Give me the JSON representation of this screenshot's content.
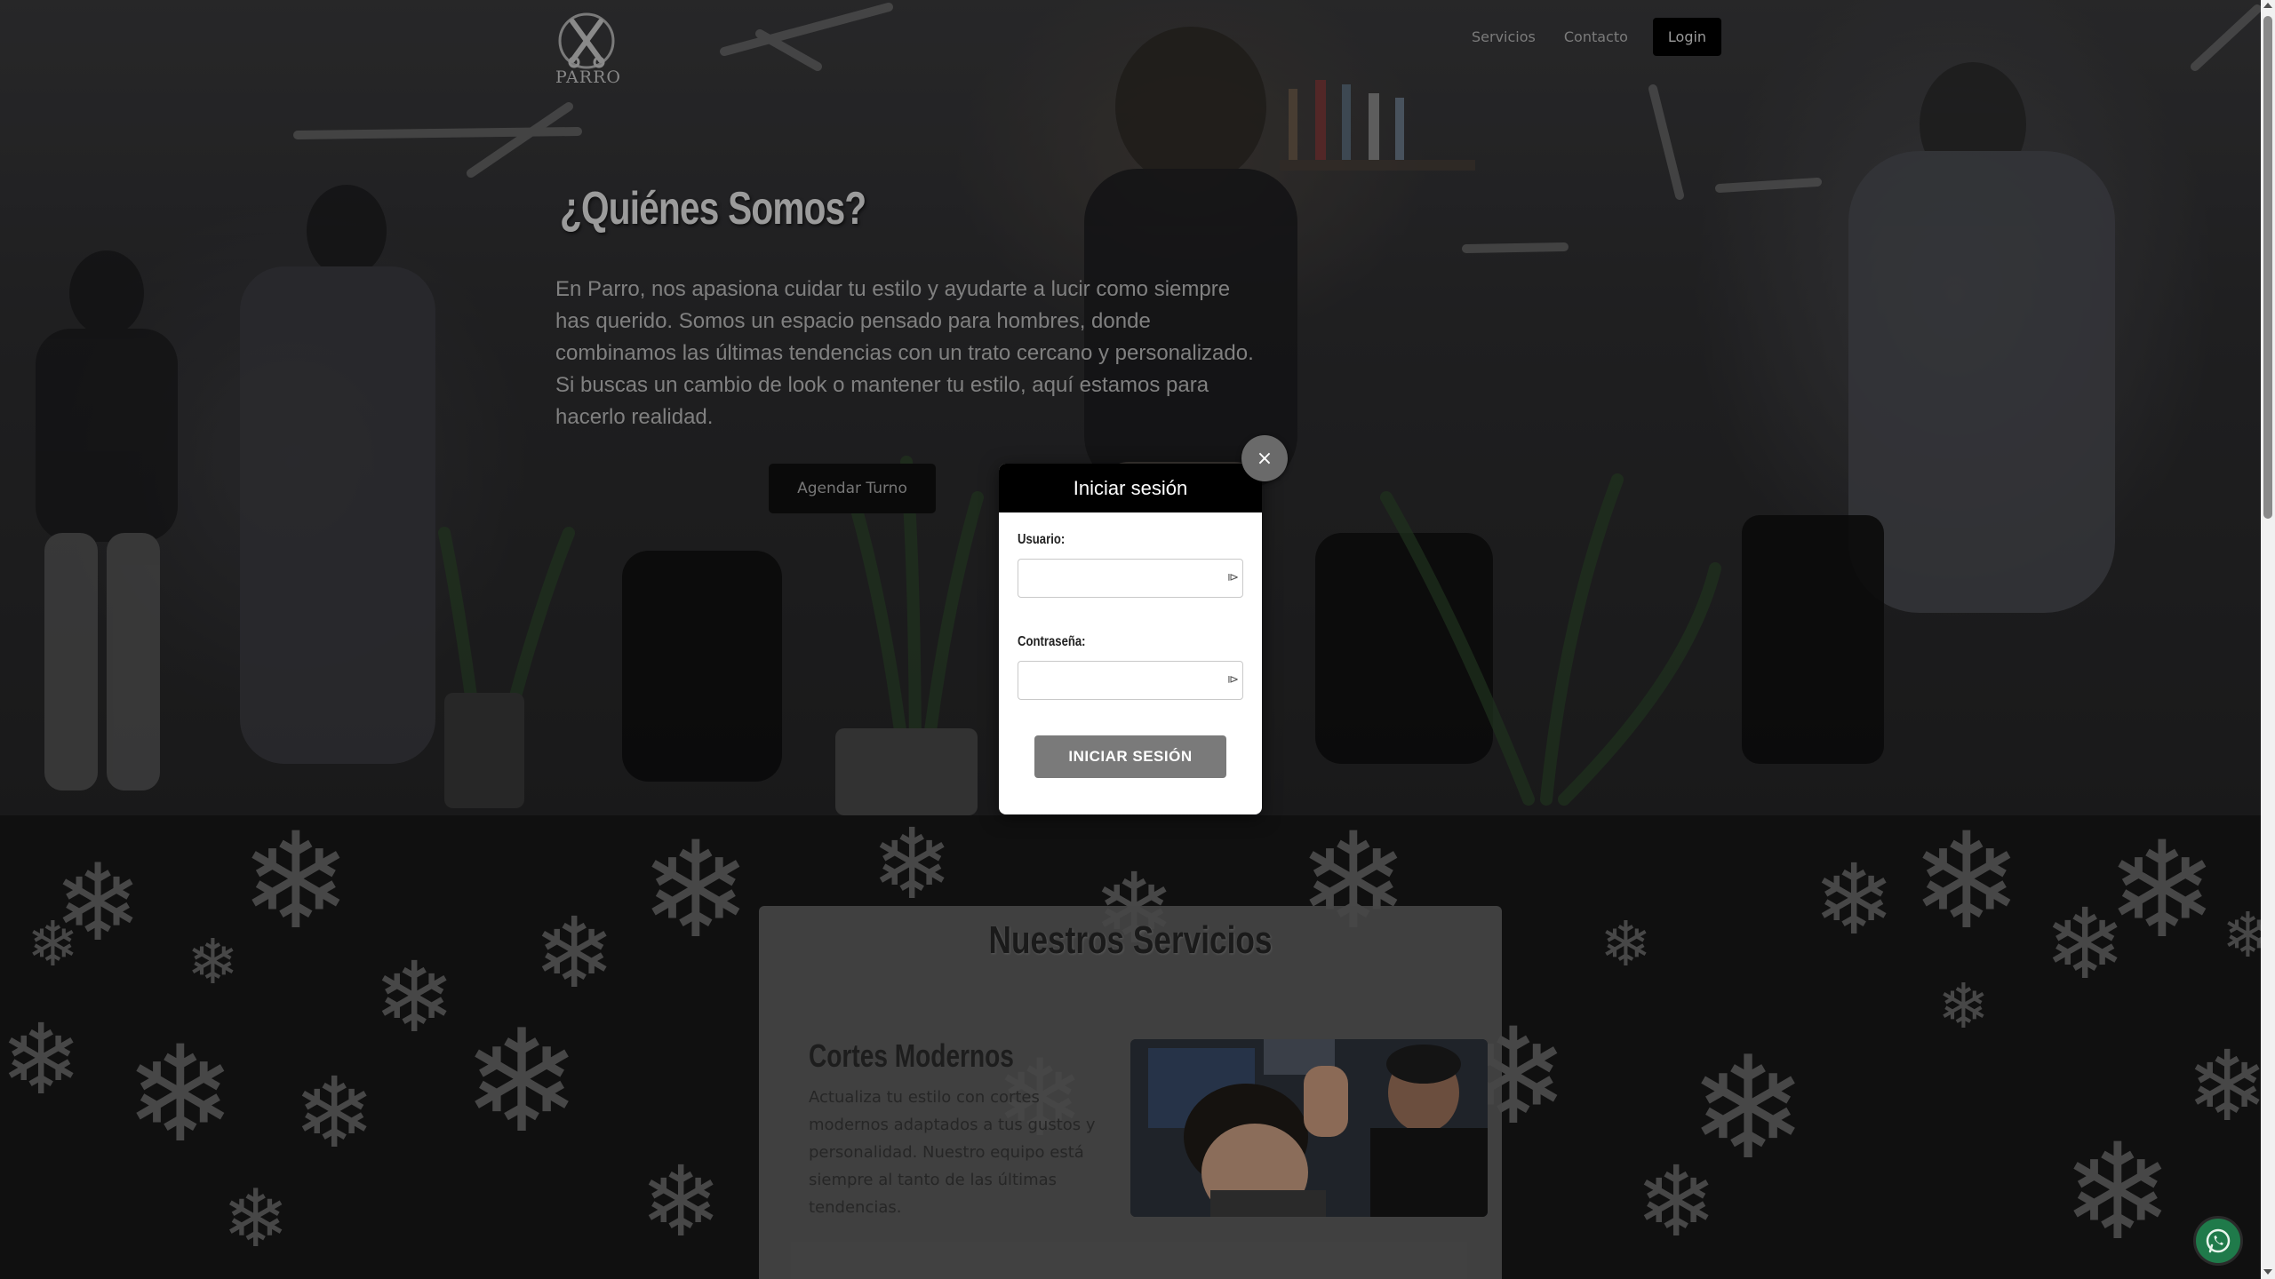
{
  "brand": {
    "logo_text": "PARRO"
  },
  "nav": {
    "servicios": "Servicios",
    "contacto": "Contacto",
    "login": "Login"
  },
  "hero": {
    "title": "¿Quiénes Somos?",
    "paragraph": "En Parro, nos apasiona cuidar tu estilo y ayudarte a lucir como siempre has querido. Somos un espacio pensado para hombres, donde combinamos las últimas tendencias con un trato cercano y personalizado. Si buscas un cambio de look o mantener tu estilo, aquí estamos para hacerlo realidad.",
    "cta": "Agendar Turno"
  },
  "services": {
    "title": "Nuestros Servicios",
    "items": [
      {
        "name": "Cortes Modernos",
        "description": "Actualiza tu estilo con cortes modernos adaptados a tus gustos y personalidad. Nuestro equipo está siempre al tanto de las últimas tendencias."
      }
    ]
  },
  "login_modal": {
    "title": "Iniciar sesión",
    "username_label": "Usuario:",
    "username_value": "",
    "password_label": "Contraseña:",
    "password_value": "",
    "submit": "INICIAR SESIÓN",
    "close": "×"
  },
  "colors": {
    "modal_header": "#000000",
    "submit_button": "#7a7a7a",
    "nav_login_bg": "#000000",
    "whatsapp": "#1f7a4a"
  },
  "icons": {
    "logo": "scissors-razor-logo",
    "close": "close-icon",
    "input_autofill": "password-manager-icon",
    "whatsapp": "whatsapp-icon",
    "background_pattern": "snowflake-icon"
  }
}
